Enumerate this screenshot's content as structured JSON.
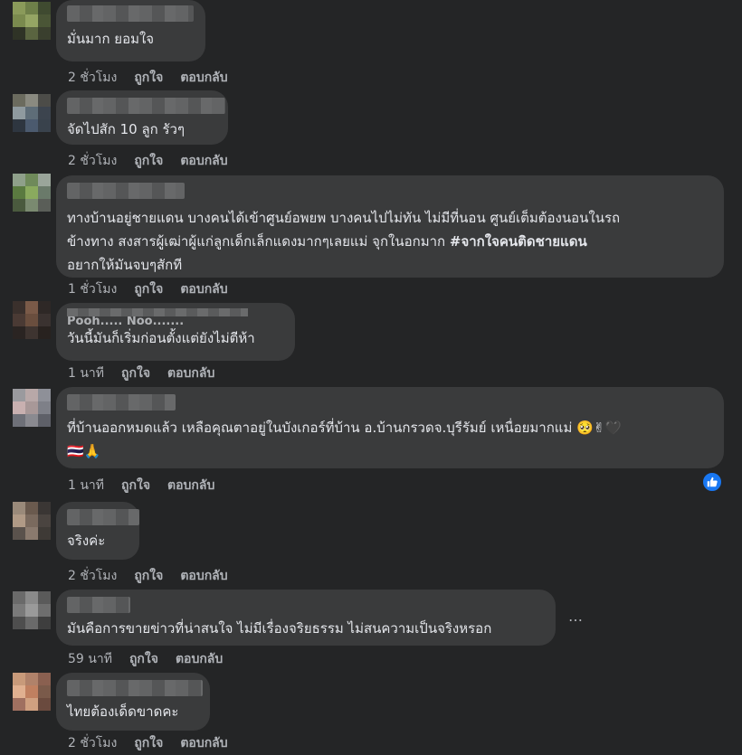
{
  "labels": {
    "like": "ถูกใจ",
    "reply": "ตอบกลับ"
  },
  "comments": [
    {
      "text": "มั่นมาก ยอมใจ",
      "time": "2 ชั่วโมง"
    },
    {
      "text": "จัดไปสัก 10 ลูก รัวๆ",
      "time": "2 ชั่วโมง"
    },
    {
      "text_line1": "ทางบ้านอยู่ชายแดน บางคนได้เข้าศูนย์อพยพ บางคนไปไม่ทัน ไม่มีที่นอน ศูนย์เต็มต้องนอนในรถ",
      "text_line2_a": "ข้างทาง สงสารผู้เฒ่าผู้แก่ลูกเด็กเล็กแดงมากๆเลยแม่ จุกในอกมาก ",
      "hashtag": "#จากใจคนติดชายแดน",
      "text_line3": "อยากให้มันจบๆสักที",
      "time": "1 ชั่วโมง"
    },
    {
      "name_partial": "Pooh..... Noo.......",
      "text": "วันนี้มันก็เริ่มก่อนตั้งแต่ยังไม่ตีห้า",
      "time": "1 นาที"
    },
    {
      "text_line1": "ที่บ้านออกหมดแล้ว เหลือคุณตาอยู่ในบังเกอร์ที่บ้าน อ.บ้านกรวดจ.บุรีรัมย์ เหนื่อยมากแม่ 🥺✌🖤",
      "text_line2": "🇹🇭🙏",
      "time": "1 นาที"
    },
    {
      "text": "จริงค่ะ",
      "time": "2 ชั่วโมง"
    },
    {
      "text": "มันคือการขายข่าวที่น่าสนใจ ไม่มีเรื่องจริยธรรม ไม่สนความเป็นจริงหรอก",
      "time": "59 นาที",
      "more": "…"
    },
    {
      "text": "ไทยต้องเด็ดขาดคะ",
      "time": "2 ชั่วโมง"
    }
  ],
  "colors": {
    "background": "#242526",
    "bubble": "#3a3b3c",
    "text": "#e4e6eb",
    "secondary_text": "#b0b3b8",
    "like_badge": "#1877f2"
  },
  "icons": {
    "like_badge": "thumbs-up-icon",
    "more": "more-options-icon"
  }
}
